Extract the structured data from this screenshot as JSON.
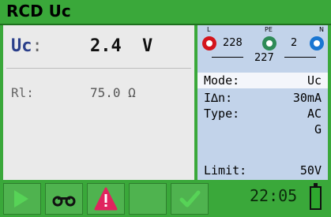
{
  "title": "RCD Uc",
  "main": {
    "uc_label": "Uc",
    "uc_colon": ":",
    "uc_value": "2.4",
    "uc_unit": "V",
    "rl_label": "Rl:",
    "rl_value": "75.0 Ω"
  },
  "terminals": {
    "l_label": "L",
    "pe_label": "PE",
    "n_label": "N",
    "l_pe": "228",
    "pe_n": "2",
    "l_n": "227"
  },
  "params": [
    {
      "key": "Mode:",
      "value": "Uc"
    },
    {
      "key": "I∆n:",
      "value": "30mA"
    },
    {
      "key": "Type:",
      "value": "AC"
    },
    {
      "key": "",
      "value": "G"
    },
    {
      "key": "Limit:",
      "value": "50V"
    }
  ],
  "status": {
    "time": "22:05"
  },
  "colors": {
    "frame": "#3aa83a",
    "panel_right": "#c2d3ea",
    "warning": "#e0245e",
    "check": "#37b24d"
  },
  "icons": [
    "play-icon",
    "headphones-icon",
    "warning-icon",
    "checkmark-icon",
    "battery-icon"
  ]
}
